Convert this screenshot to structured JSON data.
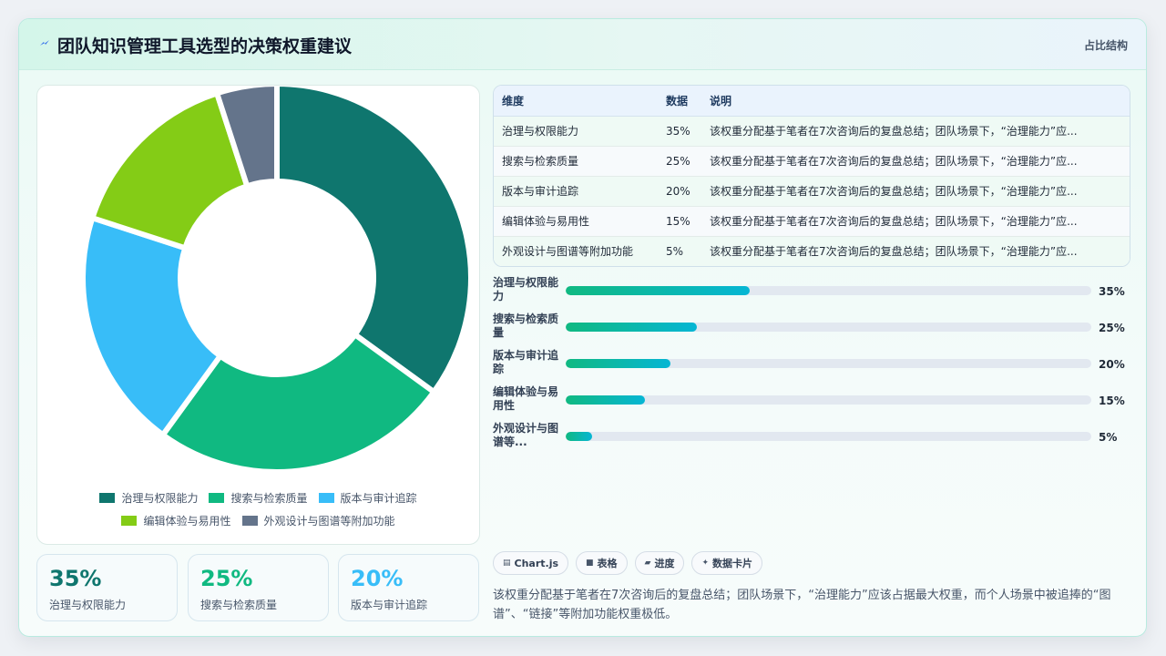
{
  "header": {
    "title": "团队知识管理工具选型的决策权重建议",
    "tag": "占比结构"
  },
  "chart_data": {
    "type": "pie",
    "donut": true,
    "categories": [
      "治理与权限能力",
      "搜索与检索质量",
      "版本与审计追踪",
      "编辑体验与易用性",
      "外观设计与图谱等附加功能"
    ],
    "values": [
      35,
      25,
      20,
      15,
      5
    ],
    "unit": "%",
    "colors": [
      "#0f766e",
      "#10b981",
      "#38bdf8",
      "#84cc16",
      "#64748b"
    ],
    "legend_position": "bottom"
  },
  "kpis": [
    {
      "value": "35%",
      "label": "治理与权限能力",
      "color": "#0f766e"
    },
    {
      "value": "25%",
      "label": "搜索与检索质量",
      "color": "#10b981"
    },
    {
      "value": "20%",
      "label": "版本与审计追踪",
      "color": "#38bdf8"
    }
  ],
  "table": {
    "headers": [
      "维度",
      "数据",
      "说明"
    ],
    "rows": [
      [
        "治理与权限能力",
        "35%",
        "该权重分配基于笔者在7次咨询后的复盘总结；团队场景下，“治理能力”应..."
      ],
      [
        "搜索与检索质量",
        "25%",
        "该权重分配基于笔者在7次咨询后的复盘总结；团队场景下，“治理能力”应..."
      ],
      [
        "版本与审计追踪",
        "20%",
        "该权重分配基于笔者在7次咨询后的复盘总结；团队场景下，“治理能力”应..."
      ],
      [
        "编辑体验与易用性",
        "15%",
        "该权重分配基于笔者在7次咨询后的复盘总结；团队场景下，“治理能力”应..."
      ],
      [
        "外观设计与图谱等附加功能",
        "5%",
        "该权重分配基于笔者在7次咨询后的复盘总结；团队场景下，“治理能力”应..."
      ]
    ]
  },
  "progress": [
    {
      "label": "治理与权限能力",
      "value": "35%",
      "fraction": 0.35
    },
    {
      "label": "搜索与检索质量",
      "value": "25%",
      "fraction": 0.25
    },
    {
      "label": "版本与审计追踪",
      "value": "20%",
      "fraction": 0.2
    },
    {
      "label": "编辑体验与易用性",
      "value": "15%",
      "fraction": 0.15
    },
    {
      "label": "外观设计与图谱等...",
      "value": "5%",
      "fraction": 0.05
    }
  ],
  "chips": [
    {
      "icon": "chart-icon",
      "glyph": "▤",
      "label": "Chart.js"
    },
    {
      "icon": "table-icon",
      "glyph": "■",
      "label": "表格"
    },
    {
      "icon": "progress-icon",
      "glyph": "▰",
      "label": "进度"
    },
    {
      "icon": "sparkle-icon",
      "glyph": "✦",
      "label": "数据卡片"
    }
  ],
  "note": "该权重分配基于笔者在7次咨询后的复盘总结；团队场景下，“治理能力”应该占据最大权重，而个人场景中被追捧的“图谱”、“链接”等附加功能权重极低。"
}
